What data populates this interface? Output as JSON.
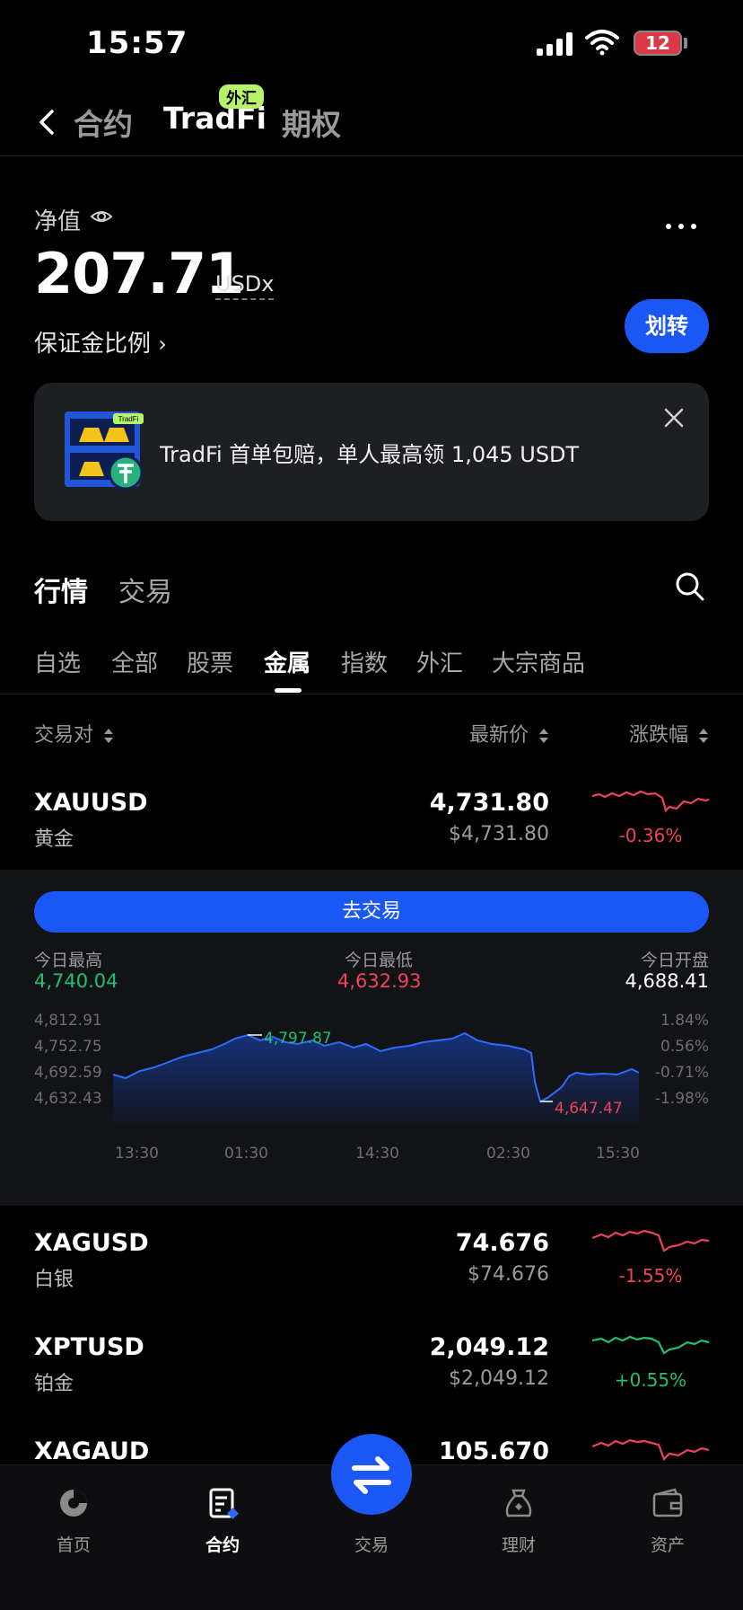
{
  "status_bar": {
    "time": "15:57",
    "battery": "12"
  },
  "top_nav": {
    "tabs": [
      {
        "label": "合约",
        "active": false
      },
      {
        "label": "TradFi",
        "active": true,
        "badge": "外汇"
      },
      {
        "label": "期权",
        "active": false
      }
    ]
  },
  "account": {
    "net_value_label": "净值",
    "net_value": "207.71",
    "unit": "USDx",
    "margin_ratio_link": "保证金比例",
    "transfer_label": "划转"
  },
  "banner": {
    "art_badge": "TradFi",
    "text": "TradFi 首单包赔，单人最高领 1,045 USDT"
  },
  "section_tabs": [
    {
      "label": "行情",
      "active": true
    },
    {
      "label": "交易",
      "active": false
    }
  ],
  "categories": [
    {
      "label": "自选",
      "active": false
    },
    {
      "label": "全部",
      "active": false
    },
    {
      "label": "股票",
      "active": false
    },
    {
      "label": "金属",
      "active": true
    },
    {
      "label": "指数",
      "active": false
    },
    {
      "label": "外汇",
      "active": false
    },
    {
      "label": "大宗商品",
      "active": false
    }
  ],
  "table": {
    "headers": {
      "pair": "交易对",
      "price": "最新价",
      "change": "涨跌幅"
    },
    "rows": [
      {
        "symbol": "XAUUSD",
        "name": "黄金",
        "price": "4,731.80",
        "usd_price": "$4,731.80",
        "change": "-0.36%",
        "direction": "down"
      },
      {
        "symbol": "XAGUSD",
        "name": "白银",
        "price": "74.676",
        "usd_price": "$74.676",
        "change": "-1.55%",
        "direction": "down"
      },
      {
        "symbol": "XPTUSD",
        "name": "铂金",
        "price": "2,049.12",
        "usd_price": "$2,049.12",
        "change": "+0.55%",
        "direction": "up"
      },
      {
        "symbol": "XAGAUD",
        "name": "",
        "price": "105.670",
        "usd_price": "",
        "change": "",
        "direction": "down"
      }
    ]
  },
  "expanded": {
    "trade_button": "去交易",
    "stats": [
      {
        "label": "今日最高",
        "value": "4,740.04",
        "color": "#1fbf75"
      },
      {
        "label": "今日最低",
        "value": "4,632.93",
        "color": "#f0435a"
      },
      {
        "label": "今日开盘",
        "value": "4,688.41",
        "color": "#ffffff"
      }
    ],
    "chart": {
      "y_left": [
        "4,812.91",
        "4,752.75",
        "4,692.59",
        "4,632.43"
      ],
      "y_right": [
        "1.84%",
        "0.56%",
        "-0.71%",
        "-1.98%"
      ],
      "x_labels": [
        "13:30",
        "01:30",
        "14:30",
        "02:30",
        "15:30"
      ],
      "high_mark": "4,797.87",
      "low_mark": "4,647.47"
    }
  },
  "bottom_nav": [
    {
      "label": "首页",
      "icon": "home-icon",
      "active": false
    },
    {
      "label": "合约",
      "icon": "contract-icon",
      "active": true
    },
    {
      "label": "交易",
      "icon": "swap-icon",
      "active": false
    },
    {
      "label": "理财",
      "icon": "finance-icon",
      "active": false
    },
    {
      "label": "资产",
      "icon": "wallet-icon",
      "active": false
    }
  ],
  "colors": {
    "accent": "#1b57f5",
    "up": "#1fbf75",
    "down": "#f0435a",
    "badge": "#b6f36a"
  }
}
